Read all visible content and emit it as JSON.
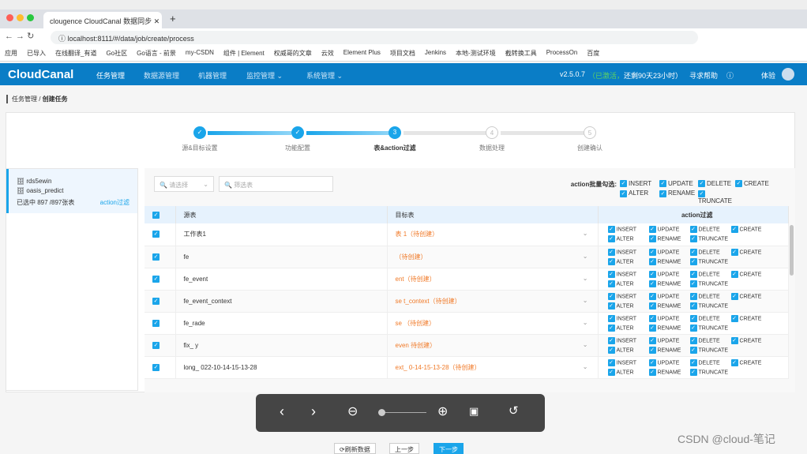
{
  "browser": {
    "tab_title": "clougence CloudCanal 数据同步",
    "url": "localhost:8111/#/data/job/create/process",
    "bookmarks": [
      "应用",
      "已导入",
      "在线翻译_有道",
      "Go社区",
      "Go语言 - 前景",
      "my-CSDN",
      "组件 | Element",
      "权威哥的文章",
      "云效",
      "Element Plus",
      "项目文档",
      "Jenkins",
      "本地-测试环境",
      "截转换工具",
      "ProcessOn",
      "百度"
    ]
  },
  "app": {
    "logo": "CloudCanal",
    "nav": [
      "任务管理",
      "数据源管理",
      "机器管理",
      "监控管理 ⌄",
      "系统管理 ⌄"
    ],
    "version": "v2.5.0.7",
    "activation": "（已激活，",
    "remaining": "还剩90天23小时）",
    "help": "寻求帮助",
    "user": "体验"
  },
  "breadcrumb": [
    "任务管理",
    "创建任务"
  ],
  "steps": [
    {
      "n": "✓",
      "label": "源&目标设置",
      "state": "done"
    },
    {
      "n": "✓",
      "label": "功能配置",
      "state": "done"
    },
    {
      "n": "3",
      "label": "表&action过滤",
      "state": "current"
    },
    {
      "n": "4",
      "label": "数据处理",
      "state": "todo"
    },
    {
      "n": "5",
      "label": "创建确认",
      "state": "todo"
    }
  ],
  "sidebar": {
    "source_db": "rds5ewin",
    "target_db": "oasis_predict",
    "selected": "已选中 897 /897张表",
    "action_link": "action过滤"
  },
  "filters": {
    "select_placeholder": "请选择",
    "search_placeholder": "筛选表"
  },
  "bulk": {
    "label": "action批量勾选:",
    "actions": [
      "INSERT",
      "UPDATE",
      "DELETE",
      "CREATE",
      "ALTER",
      "RENAME",
      "TRUNCATE"
    ]
  },
  "table": {
    "headers": [
      "源表",
      "目标表",
      "action过滤"
    ],
    "rows": [
      {
        "source": "工作表1",
        "target": "表 1（待创建）"
      },
      {
        "source": "fe",
        "target": "（待创建）"
      },
      {
        "source": "fe_event",
        "target": "ent（待创建）"
      },
      {
        "source": "fe_event_context",
        "target": "se t_context（待创建）"
      },
      {
        "source": "fe_rade",
        "target": "se （待创建）"
      },
      {
        "source": "fix_ y",
        "target": "even 待创建）"
      },
      {
        "source": "long_ 022-10-14-15-13-28",
        "target": "ext_ 0-14-15-13-28（待创建）"
      }
    ]
  },
  "footer": {
    "refresh": "⟳刷新数据",
    "prev": "上一步",
    "next": "下一步"
  },
  "watermark": "CSDN @cloud-笔记",
  "colors": {
    "brand": "#0a7dc6",
    "accent": "#1aa5ea",
    "target_text": "#f07a28"
  }
}
